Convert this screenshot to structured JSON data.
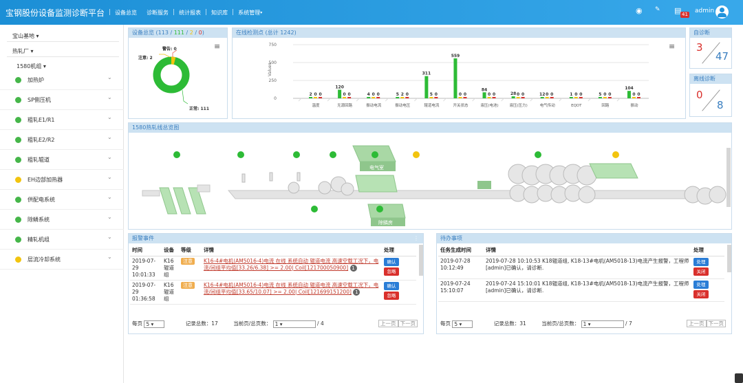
{
  "header": {
    "brand": "宝钢股份设备监测诊断平台",
    "nav": [
      "设备总览",
      "诊断服务",
      "统计报表",
      "知识库",
      "系统管理"
    ],
    "badge": "41",
    "user": "admin"
  },
  "sidebar": {
    "base": "宝山基地",
    "plant": "热轧厂",
    "line": "1580机组",
    "items": [
      {
        "label": "加热炉",
        "status": "green"
      },
      {
        "label": "SP侧压机",
        "status": "green"
      },
      {
        "label": "粗轧E1/R1",
        "status": "green"
      },
      {
        "label": "粗轧E2/R2",
        "status": "green"
      },
      {
        "label": "粗轧辊道",
        "status": "green"
      },
      {
        "label": "EH边部加热器",
        "status": "yellow"
      },
      {
        "label": "供配电系统",
        "status": "green"
      },
      {
        "label": "除鳞系统",
        "status": "green"
      },
      {
        "label": "精轧机组",
        "status": "green"
      },
      {
        "label": "层流冷却系统",
        "status": "yellow"
      }
    ]
  },
  "overview": {
    "title_a": "设备总览 (113 / ",
    "title_b": "111",
    "title_c": " / ",
    "title_d": "2",
    "title_e": " / ",
    "title_f": "0",
    "title_g": ")",
    "warn": "警告: 0",
    "note": "注意: 2",
    "normal": "正常: 111"
  },
  "points": {
    "title": "在线检测点 (总计 1242)",
    "ylabel": "Values"
  },
  "chart_data": {
    "type": "bar",
    "title": "在线检测点 (总计 1242)",
    "ylabel": "Values",
    "ylim": [
      0,
      750
    ],
    "yticks": [
      "750",
      "500",
      "250",
      "0"
    ],
    "categories": [
      "温度",
      "无源回路",
      "振动电流",
      "振动电压",
      "辊道电流",
      "开关状态",
      "液压(电池)",
      "液压(压力)",
      "电气传动",
      "EQDT",
      "回路",
      "振动"
    ],
    "series": [
      {
        "name": "正常",
        "color": "#2dbb36",
        "values": [
          2,
          120,
          4,
          5,
          311,
          559,
          84,
          28,
          12,
          1,
          5,
          104
        ]
      },
      {
        "name": "注意",
        "color": "#f2c40f",
        "values": [
          0,
          0,
          0,
          2,
          5,
          0,
          0,
          0,
          0,
          0,
          0,
          0
        ]
      },
      {
        "name": "警告",
        "color": "#d9302c",
        "values": [
          0,
          0,
          0,
          0,
          0,
          0,
          0,
          0,
          0,
          0,
          0,
          0
        ]
      }
    ],
    "labels": [
      [
        "2",
        "0",
        "0"
      ],
      [
        "120",
        "0",
        "0"
      ],
      [
        "4",
        "0",
        "0"
      ],
      [
        "5",
        "2",
        "0"
      ],
      [
        "311",
        "5",
        "0"
      ],
      [
        "559",
        "0",
        "0"
      ],
      [
        "84",
        "0",
        "0"
      ],
      [
        "28",
        "0",
        "0"
      ],
      [
        "12",
        "0",
        "0"
      ],
      [
        "1",
        "0",
        "0"
      ],
      [
        "5",
        "0",
        "0"
      ],
      [
        "104",
        "0",
        "0"
      ]
    ]
  },
  "diag": {
    "title": "自诊断",
    "num": "3",
    "den": "47"
  },
  "offline": {
    "title": "离线诊断",
    "num": "0",
    "den": "8"
  },
  "line": {
    "title": "1580热轧线总览图",
    "room1": "电气室",
    "room2": "除鳞房"
  },
  "alarm": {
    "title": "报警事件",
    "cols": [
      "时间",
      "设备",
      "等级",
      "详情",
      "处理"
    ],
    "rows": [
      {
        "time": "2019-07-29 10:01:33",
        "dev": "K16辊道组",
        "level": "注意",
        "detail": "K16-4#电机(AM5016-4)电流 在线 系统自动 辊道电流 高速空载工况下，电流/间组平均值[33.26/6.38] >= 2.00| Coil[121700050900]",
        "n": "1",
        "confirm": "确认",
        "ignore": "忽略"
      },
      {
        "time": "2019-07-29 01:36:58",
        "dev": "K16辊道组",
        "level": "注意",
        "detail": "K16-4#电机(AM5016-4)电流 在线 系统自动 辊道电流 高速空载工况下，电流/间组平均值[33.65/10.07] >= 2.00| Coil[121699151200]",
        "n": "1",
        "confirm": "确认",
        "ignore": "忽略"
      }
    ],
    "pager": {
      "per": "每页",
      "size": "5",
      "total": "记录总数：17",
      "cur": "当前页/总页数：",
      "page": "1",
      "pages": "/ 4",
      "prev": "上一页",
      "next": "下一页"
    }
  },
  "todo": {
    "title": "待办事项",
    "cols": [
      "任务生成时间",
      "详情",
      "处理"
    ],
    "rows": [
      {
        "time": "2019-07-28 10:12:49",
        "detail": "2019-07-28 10:10:53 K18辊道组, K18-13#电机(AM5018-13)电流产生报警，工程师[admin]已确认，请诊断.",
        "a": "处理",
        "b": "关闭"
      },
      {
        "time": "2019-07-24 15:10:07",
        "detail": "2019-07-24 15:10:01 K18辊道组, K18-13#电机(AM5018-13)电流产生报警，工程师[admin]已确认，请诊断.",
        "a": "处理",
        "b": "关闭"
      }
    ],
    "pager": {
      "per": "每页",
      "size": "5",
      "total": "记录总数：31",
      "cur": "当前页/总页数：",
      "page": "1",
      "pages": "/ 7",
      "prev": "上一页",
      "next": "下一页"
    }
  }
}
